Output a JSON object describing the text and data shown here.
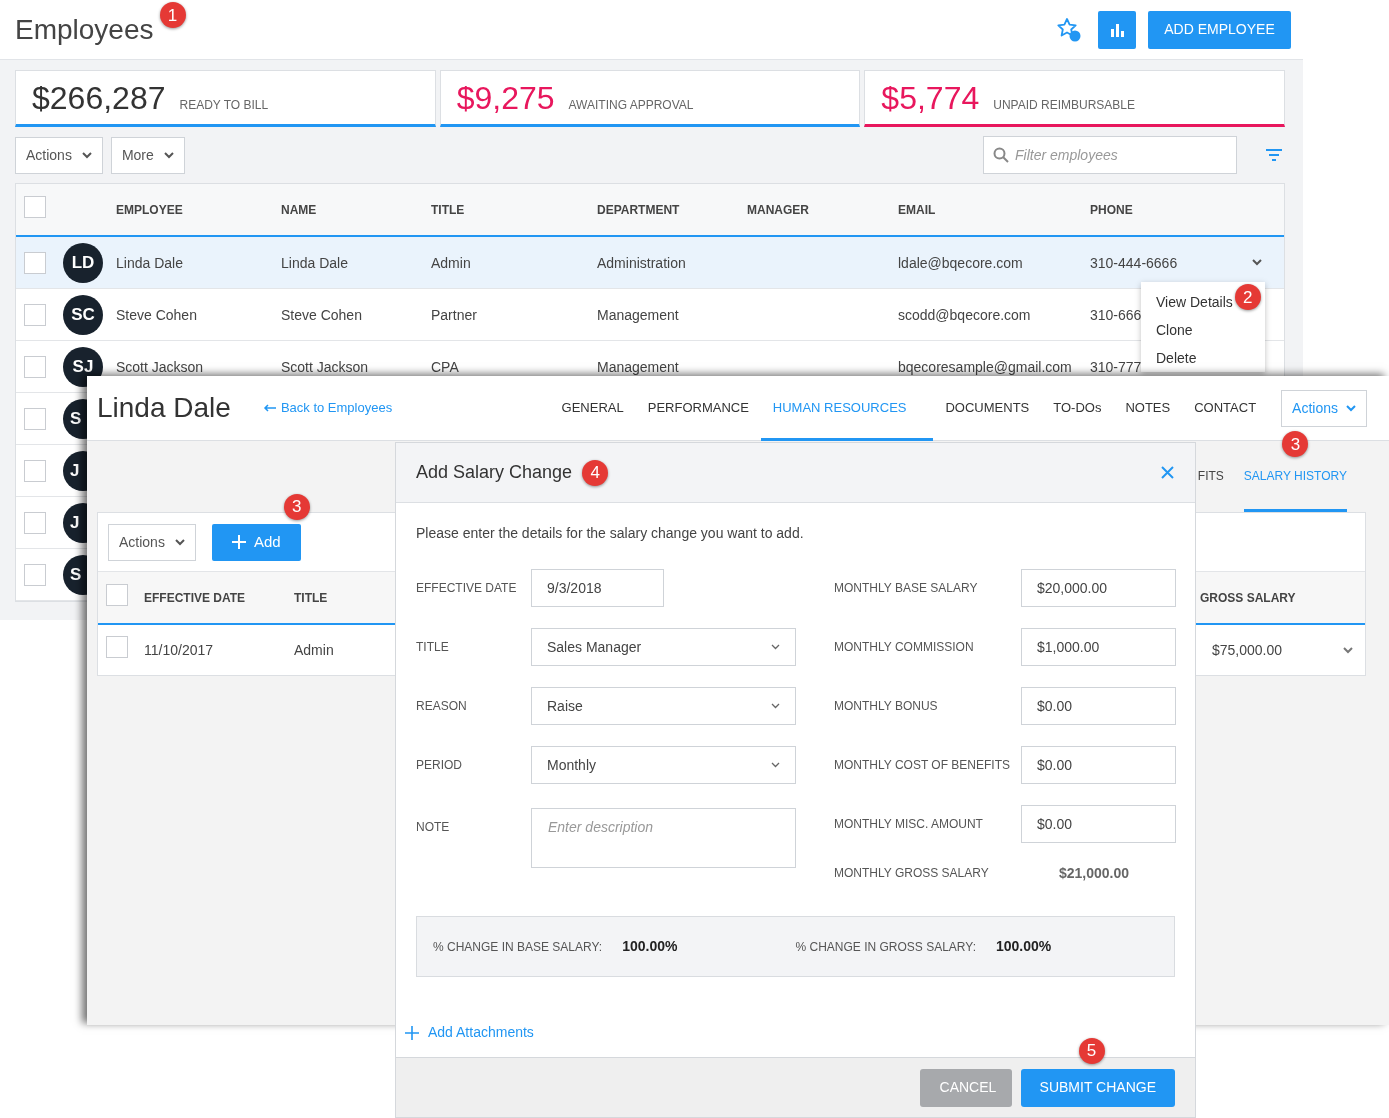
{
  "header": {
    "title": "Employees",
    "callout": "1",
    "add_button": "ADD EMPLOYEE"
  },
  "summary": [
    {
      "kind": "neutral",
      "amount": "$266,287",
      "label": "READY TO BILL",
      "color": "#2196f3"
    },
    {
      "kind": "alert",
      "amount": "$9,275",
      "label": "AWAITING APPROVAL",
      "color": "#2196f3"
    },
    {
      "kind": "alert",
      "amount": "$5,774",
      "label": "UNPAID REIMBURSABLE",
      "color": "#e8175d"
    }
  ],
  "toolbar": {
    "actions": "Actions",
    "more": "More",
    "filter_placeholder": "Filter employees"
  },
  "table": {
    "header_checked": false,
    "columns": [
      "EMPLOYEE",
      "NAME",
      "TITLE",
      "DEPARTMENT",
      "MANAGER",
      "EMAIL",
      "PHONE"
    ],
    "rows": [
      {
        "kind": "full",
        "selected": true,
        "checked": false,
        "initials": "LD",
        "employee": "Linda Dale",
        "name": "Linda Dale",
        "title": "Admin",
        "department": "Administration",
        "email": "ldale@bqecore.com",
        "phone": "310-444-6666"
      },
      {
        "kind": "full",
        "selected": false,
        "checked": false,
        "initials": "SC",
        "employee": "Steve Cohen",
        "name": "Steve Cohen",
        "title": "Partner",
        "department": "Management",
        "email": "scodd@bqecore.com",
        "phone": "310-666"
      },
      {
        "kind": "full",
        "selected": false,
        "checked": false,
        "initials": "SJ",
        "employee": "Scott Jackson",
        "name": "Scott Jackson",
        "title": "CPA",
        "department": "Management",
        "email": "bqecoresample@gmail.com",
        "phone": "310-777"
      },
      {
        "kind": "covered",
        "checked": false,
        "initials": "S"
      },
      {
        "kind": "covered",
        "checked": false,
        "initials": "J"
      },
      {
        "kind": "covered",
        "checked": false,
        "initials": "J"
      },
      {
        "kind": "covered",
        "checked": false,
        "initials": "S"
      }
    ]
  },
  "row_menu": {
    "items": [
      {
        "label": "View Details",
        "callout": "2"
      },
      {
        "label": "Clone"
      },
      {
        "label": "Delete"
      }
    ]
  },
  "employee_window": {
    "title": "Linda Dale",
    "back_link": "Back to Employees",
    "tabs": [
      {
        "label": "GENERAL",
        "selected": false
      },
      {
        "label": "PERFORMANCE",
        "selected": false
      },
      {
        "label": "HUMAN RESOURCES",
        "selected": true
      },
      {
        "label": "DOCUMENTS",
        "selected": false
      },
      {
        "label": "TO-DOs",
        "selected": false
      },
      {
        "label": "NOTES",
        "selected": false
      },
      {
        "label": "CONTACT",
        "selected": false
      }
    ],
    "actions": "Actions",
    "subtabs": [
      {
        "label": "FITS",
        "selected": false
      },
      {
        "label": "SALARY HISTORY",
        "selected": true,
        "callout": "3"
      }
    ],
    "salary_table": {
      "actions": "Actions",
      "add_button": "Add",
      "add_callout": "3",
      "header_checked": false,
      "columns": [
        "EFFECTIVE DATE",
        "TITLE",
        "GROSS SALARY"
      ],
      "rows": [
        {
          "checked": false,
          "effective_date": "11/10/2017",
          "title": "Admin",
          "gross_salary": "$75,000.00"
        }
      ]
    }
  },
  "modal": {
    "title": "Add Salary Change",
    "callout": "4",
    "intro": "Please enter the details for the salary change you want to add.",
    "left_fields": [
      {
        "kind": "text",
        "label": "EFFECTIVE DATE",
        "value": "9/3/2018"
      },
      {
        "kind": "select",
        "label": "TITLE",
        "value": "Sales Manager"
      },
      {
        "kind": "select",
        "label": "REASON",
        "value": "Raise"
      },
      {
        "kind": "select",
        "label": "PERIOD",
        "value": "Monthly"
      },
      {
        "kind": "textarea",
        "label": "NOTE",
        "placeholder": "Enter description"
      }
    ],
    "right_fields": [
      {
        "kind": "text",
        "label": "MONTHLY BASE SALARY",
        "value": "$20,000.00"
      },
      {
        "kind": "text",
        "label": "MONTHLY COMMISSION",
        "value": "$1,000.00"
      },
      {
        "kind": "text",
        "label": "MONTHLY BONUS",
        "value": "$0.00"
      },
      {
        "kind": "text",
        "label": "MONTHLY COST OF BENEFITS",
        "value": "$0.00"
      },
      {
        "kind": "text",
        "label": "MONTHLY MISC. AMOUNT",
        "value": "$0.00"
      },
      {
        "kind": "readout",
        "label": "MONTHLY GROSS SALARY",
        "value": "$21,000.00"
      }
    ],
    "summary": [
      {
        "label": "% CHANGE IN BASE SALARY:",
        "value": "100.00%"
      },
      {
        "label": "% CHANGE IN GROSS SALARY:",
        "value": "100.00%"
      }
    ],
    "attach_link": "Add Attachments",
    "buttons": [
      {
        "kind": "secondary",
        "label": "CANCEL"
      },
      {
        "kind": "primary",
        "label": "SUBMIT CHANGE",
        "callout": "5"
      }
    ]
  }
}
